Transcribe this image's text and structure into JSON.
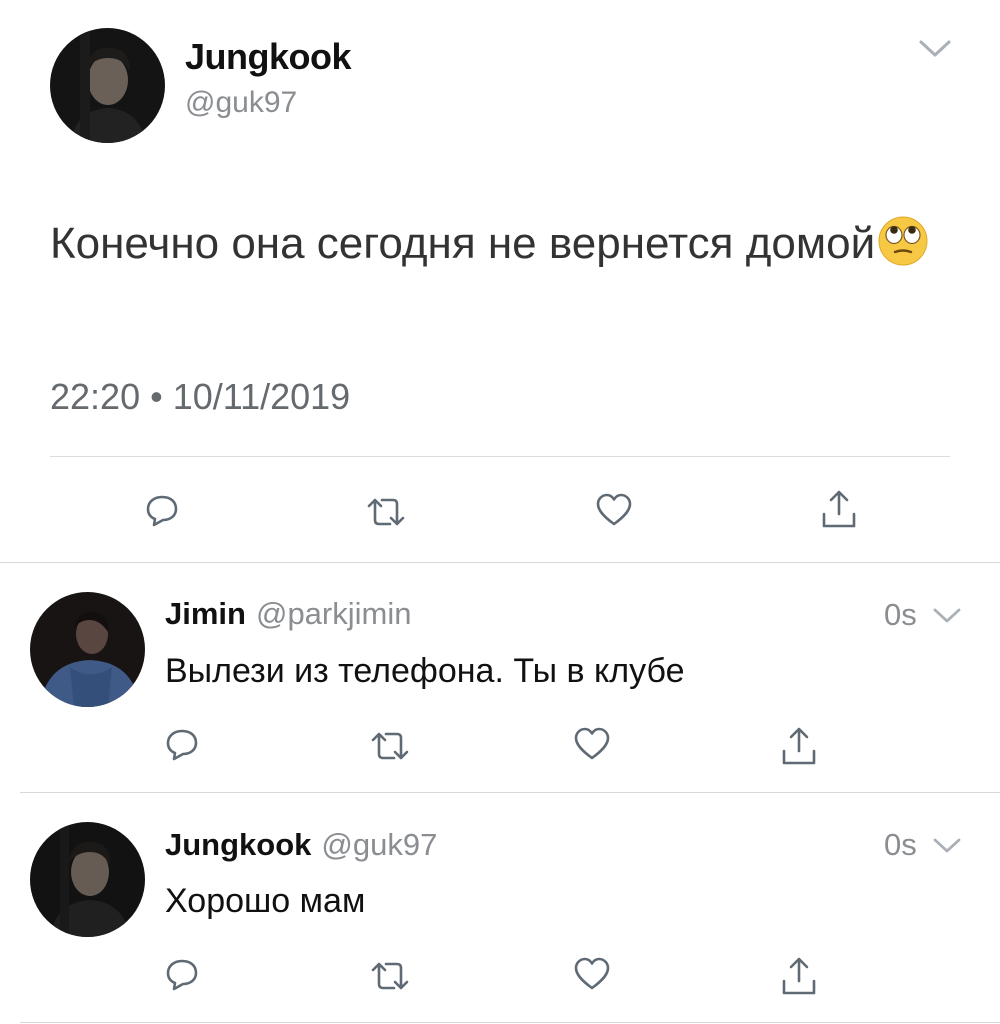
{
  "main_tweet": {
    "author_name": "Jungkook",
    "author_handle": "@guk97",
    "text": "Конечно она сегодня не вернется домой",
    "emoji": "face-with-rolling-eyes",
    "timestamp": "22:20 • 10/11/2019",
    "actions": [
      "reply-icon",
      "retweet-icon",
      "like-icon",
      "share-icon"
    ]
  },
  "replies": [
    {
      "author_name": "Jimin",
      "author_handle": "@parkjimin",
      "time": "0s",
      "text": "Вылези из телефона. Ты в клубе"
    },
    {
      "author_name": "Jungkook",
      "author_handle": "@guk97",
      "time": "0s",
      "text": "Хорошо мам"
    }
  ],
  "colors": {
    "name": "#111111",
    "secondary": "#8a8d91",
    "icon": "#5f6a75",
    "divider": "#d4d8dc"
  }
}
